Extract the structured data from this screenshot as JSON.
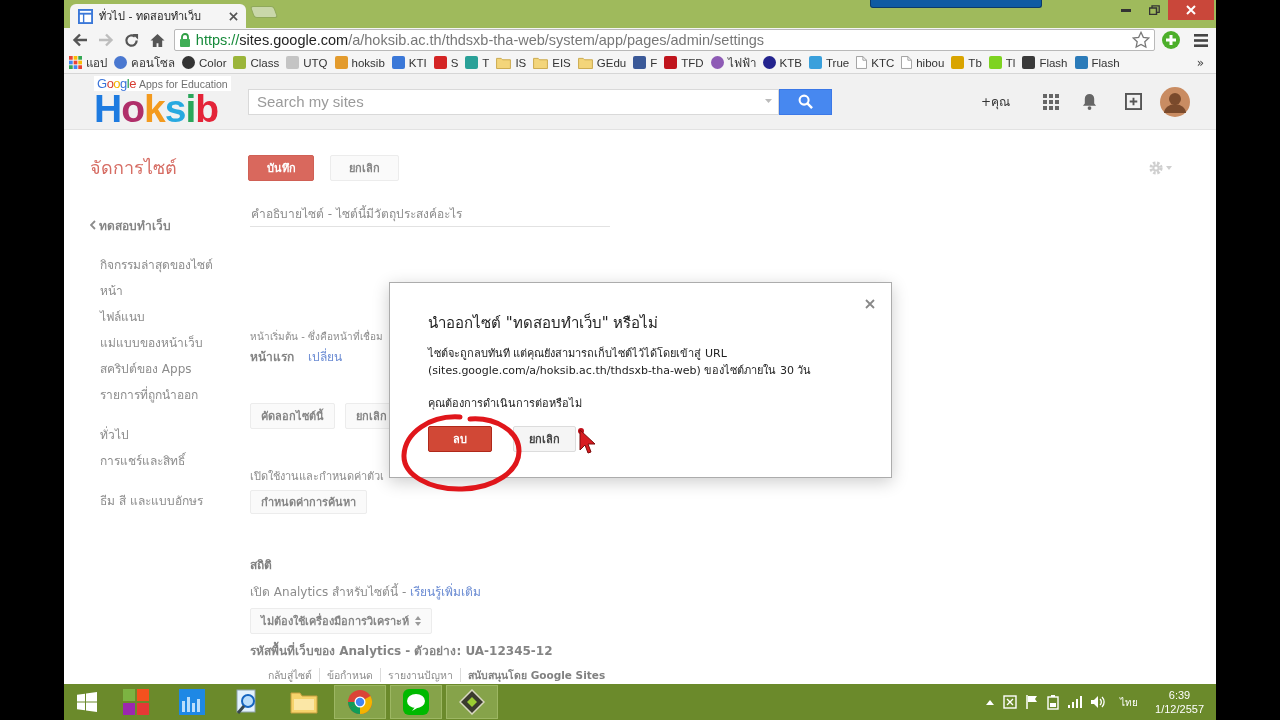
{
  "window": {
    "tab_title": "ทั่วไป - ทดสอบทำเว็บ",
    "forward_disabled": true,
    "url": {
      "scheme": "https://",
      "host": "sites.google.com",
      "path": "/a/hoksib.ac.th/thdsxb-tha-web/system/app/pages/admin/settings"
    }
  },
  "bookmarks": {
    "items": [
      {
        "kind": "apps",
        "label": "แอป"
      },
      {
        "kind": "round",
        "label": "คอนโซล",
        "color": "#4a78d0"
      },
      {
        "kind": "round",
        "label": "Color",
        "color": "#333333"
      },
      {
        "kind": "square",
        "label": "Class",
        "color": "#9bb53a"
      },
      {
        "kind": "square",
        "label": "UTQ",
        "color": "#c4c4c4"
      },
      {
        "kind": "square",
        "label": "hoksib",
        "color": "#e39b2d"
      },
      {
        "kind": "square",
        "label": "KTI",
        "color": "#3b78d8"
      },
      {
        "kind": "square",
        "label": "S",
        "color": "#d42424"
      },
      {
        "kind": "square",
        "label": "T",
        "color": "#2aa198"
      },
      {
        "kind": "folder",
        "label": "IS"
      },
      {
        "kind": "folder",
        "label": "EIS"
      },
      {
        "kind": "folder",
        "label": "GEdu"
      },
      {
        "kind": "square",
        "label": "F",
        "color": "#3b5998"
      },
      {
        "kind": "square",
        "label": "TFD",
        "color": "#c0141c"
      },
      {
        "kind": "round",
        "label": "ไฟฟ้า",
        "color": "#8e5bb5"
      },
      {
        "kind": "round",
        "label": "KTB",
        "color": "#23238e"
      },
      {
        "kind": "square",
        "label": "True",
        "color": "#3aa0dc"
      },
      {
        "kind": "page",
        "label": "KTC"
      },
      {
        "kind": "page",
        "label": "hibou"
      },
      {
        "kind": "square",
        "label": "Tb",
        "color": "#d9a400"
      },
      {
        "kind": "square",
        "label": "Tl",
        "color": "#7ed321"
      },
      {
        "kind": "square",
        "label": "Flash",
        "color": "#3a3a3a"
      },
      {
        "kind": "square",
        "label": "Flash",
        "color": "#2b7bb9"
      }
    ],
    "more": "»"
  },
  "header": {
    "logo": {
      "brand": "Google",
      "tagline": "Apps for Education",
      "name": "Hoksib"
    },
    "search": {
      "placeholder": "Search my sites"
    },
    "user_link": "+คุณ"
  },
  "settings": {
    "title": "จัดการไซต์",
    "buttons": [
      {
        "label": "บันทึก",
        "kind": "primary"
      },
      {
        "label": "ยกเลิก",
        "kind": "plain"
      }
    ],
    "description_placeholder": "คำอธิบายไซต์ - ไซต์นี้มีวัตถุประสงค์อะไร"
  },
  "sidebar": {
    "back_link": "ทดสอบทำเว็บ",
    "groups": [
      {
        "items": [
          {
            "label": "กิจกรรมล่าสุดของไซต์"
          },
          {
            "label": "หน้า"
          },
          {
            "label": "ไฟล์แนบ"
          },
          {
            "label": "แม่แบบของหน้าเว็บ"
          },
          {
            "label": "สคริปต์ของ Apps"
          },
          {
            "label": "รายการที่ถูกนำออก"
          }
        ]
      },
      {
        "items": [
          {
            "label": "ทั่วไป"
          },
          {
            "label": "การแชร์และสิทธิ์"
          }
        ]
      },
      {
        "items": [
          {
            "label": "ธีม สี และแบบอักษร"
          }
        ]
      }
    ]
  },
  "main": {
    "start_page": {
      "label": "หน้าเริ่มต้น - ซึ่งคือหน้าที่เชื่อม",
      "value": "หน้าแรก",
      "change_link": "เปลี่ยน"
    },
    "site_buttons": [
      {
        "label": "คัดลอกไซต์นี้"
      },
      {
        "label": "ยกเลิก"
      }
    ],
    "search_settings": {
      "text": "เปิดใช้งานและกำหนดค่าตัวเ",
      "button": "กำหนดค่าการค้นหา"
    },
    "statistics": {
      "heading": "สถิติ",
      "analytics_text": "เปิด Analytics สำหรับไซต์นี้ -",
      "learn_more_link": "เรียนรู้เพิ่มเติม",
      "select": "ไม่ต้องใช้เครื่องมือการวิเคราะห์",
      "property_id": "รหัสพื้นที่เว็บของ Analytics - ตัวอย่าง: UA-12345-12"
    },
    "footer_links": [
      "กลับสู่ไซต์",
      "ข้อกำหนด",
      "รายงานปัญหา",
      "สนับสนุนโดย Google Sites"
    ]
  },
  "dialog": {
    "title": "นำออกไซต์ \"ทดสอบทำเว็บ\" หรือไม่",
    "message": "ไซต์จะถูกลบทันที แต่คุณยังสามารถเก็บไซต์ไว้ได้โดยเข้าสู่ URL (sites.google.com/a/hoksib.ac.th/thdsxb-tha-web) ของไซต์ภายใน 30 วัน",
    "question": "คุณต้องการดำเนินการต่อหรือไม่",
    "buttons": [
      {
        "label": "ลบ",
        "kind": "danger"
      },
      {
        "label": "ยกเลิก",
        "kind": "plain"
      }
    ]
  },
  "taskbar": {
    "apps": [
      {
        "kind": "tiles",
        "active": false
      },
      {
        "kind": "chart",
        "active": false
      },
      {
        "kind": "magnifier",
        "active": false
      },
      {
        "kind": "folder",
        "active": false
      },
      {
        "kind": "browser",
        "active": true
      },
      {
        "kind": "chat",
        "active": true
      },
      {
        "kind": "diamond",
        "active": true
      }
    ],
    "language": "ไทย",
    "time": "6:39",
    "date": "1/12/2557"
  }
}
